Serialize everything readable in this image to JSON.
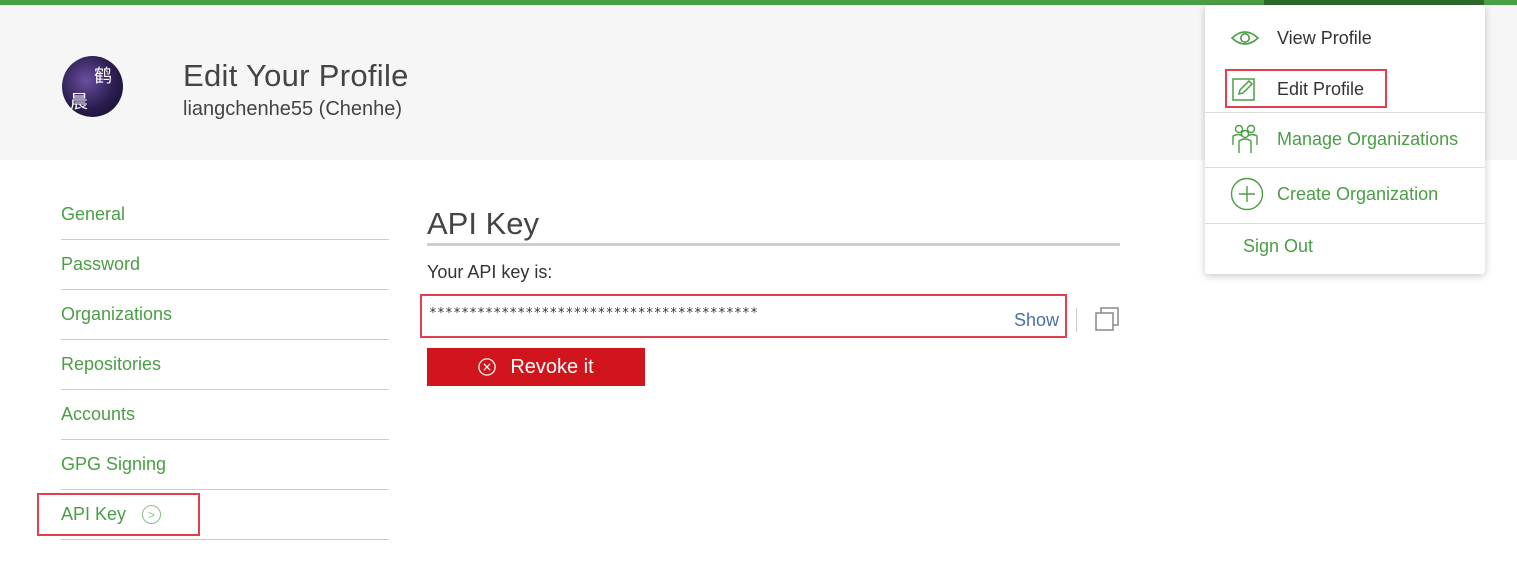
{
  "header": {
    "title": "Edit Your Profile",
    "username": "liangchenhe55 (Chenhe)",
    "avatar_chars": [
      "鹤",
      "晨"
    ]
  },
  "sidebar": {
    "items": [
      {
        "label": "General"
      },
      {
        "label": "Password"
      },
      {
        "label": "Organizations"
      },
      {
        "label": "Repositories"
      },
      {
        "label": "Accounts"
      },
      {
        "label": "GPG Signing"
      },
      {
        "label": "API Key",
        "active": true
      }
    ]
  },
  "main": {
    "section_title": "API Key",
    "api_label": "Your API key is:",
    "api_value": "*****************************************",
    "show_label": "Show",
    "revoke_label": "Revoke it"
  },
  "dropdown": {
    "items": [
      {
        "label": "View Profile",
        "icon": "eye-icon"
      },
      {
        "label": "Edit Profile",
        "icon": "edit-icon"
      },
      {
        "label": "Manage Organizations",
        "icon": "people-icon"
      },
      {
        "label": "Create Organization",
        "icon": "plus-circle-icon"
      },
      {
        "label": "Sign Out"
      }
    ]
  },
  "colors": {
    "accent_green": "#4a9e45",
    "danger_red": "#d0161c",
    "highlight_red": "#e04050",
    "link_blue": "#4a6fa5"
  }
}
